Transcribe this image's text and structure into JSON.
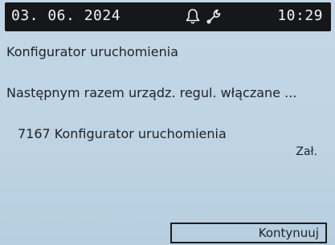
{
  "status_bar": {
    "date": "03. 06. 2024",
    "time": "10:29",
    "icons": [
      "bell-icon",
      "wrench-icon"
    ]
  },
  "screen": {
    "title": "Konfigurator uruchomienia",
    "message": "Następnym razem urządz. regul. włączane ...",
    "parameter": {
      "label": "7167 Konfigurator uruchomienia",
      "value": "Zał."
    }
  },
  "actions": {
    "continue_label": "Kontynuuj"
  },
  "colors": {
    "background": "#bed4e4",
    "status_bar": "#15171a",
    "status_text": "#f2f4f5",
    "text": "#1e2226"
  }
}
